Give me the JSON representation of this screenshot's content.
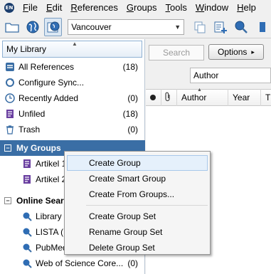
{
  "menubar": {
    "app_icon_text": "EN",
    "items": [
      {
        "label": "File",
        "accel": "F",
        "rest": "ile"
      },
      {
        "label": "Edit",
        "accel": "E",
        "rest": "dit"
      },
      {
        "label": "References",
        "accel": "R",
        "rest": "eferences"
      },
      {
        "label": "Groups",
        "accel": "G",
        "rest": "roups"
      },
      {
        "label": "Tools",
        "accel": "T",
        "rest": "ools"
      },
      {
        "label": "Window",
        "accel": "W",
        "rest": "indow"
      },
      {
        "label": "Help",
        "accel": "H",
        "rest": "elp"
      }
    ]
  },
  "toolbar": {
    "style_value": "Vancouver",
    "icons": [
      "folder-icon",
      "globe-icon",
      "globe-library-icon",
      "copy-icon",
      "add-reference-icon",
      "search-online-icon"
    ]
  },
  "library": {
    "header": "My Library",
    "items": [
      {
        "label": "All References",
        "count": "(18)",
        "icon": "all-references-icon"
      },
      {
        "label": "Configure Sync...",
        "count": "",
        "icon": "sync-icon"
      },
      {
        "label": "Recently Added",
        "count": "(0)",
        "icon": "clock-icon"
      },
      {
        "label": "Unfiled",
        "count": "(18)",
        "icon": "unfiled-icon"
      },
      {
        "label": "Trash",
        "count": "(0)",
        "icon": "trash-icon"
      }
    ],
    "my_groups": {
      "label": "My Groups",
      "toggle": "−",
      "items": [
        {
          "label": "Artikel 1",
          "icon": "group-icon"
        },
        {
          "label": "Artikel 2",
          "icon": "group-icon"
        }
      ]
    },
    "online_search": {
      "label": "Online Search",
      "toggle": "−",
      "items": [
        {
          "label": "Library",
          "count": "",
          "icon": "search-globe-icon"
        },
        {
          "label": "LISTA (E",
          "count": "",
          "icon": "search-globe-icon"
        },
        {
          "label": "PubMed",
          "count": "",
          "icon": "search-globe-icon"
        },
        {
          "label": "Web of Science Core...",
          "count": "(0)",
          "icon": "search-globe-icon"
        }
      ]
    }
  },
  "right": {
    "search_placeholder": "Search",
    "options_label": "Options",
    "options_arrow": "▸",
    "field_value": "Author",
    "columns": {
      "author": "Author",
      "year": "Year",
      "title_fragment": "T"
    }
  },
  "context_menu": {
    "items": [
      {
        "label": "Create Group",
        "hover": true
      },
      {
        "label": "Create Smart Group",
        "hover": false
      },
      {
        "label": "Create From Groups...",
        "hover": false
      }
    ],
    "items2": [
      {
        "label": "Create Group Set"
      },
      {
        "label": "Rename Group Set"
      },
      {
        "label": "Delete Group Set"
      }
    ]
  },
  "colors": {
    "selection": "#3a6ea5",
    "menu_hover": "#e5f0fb"
  }
}
